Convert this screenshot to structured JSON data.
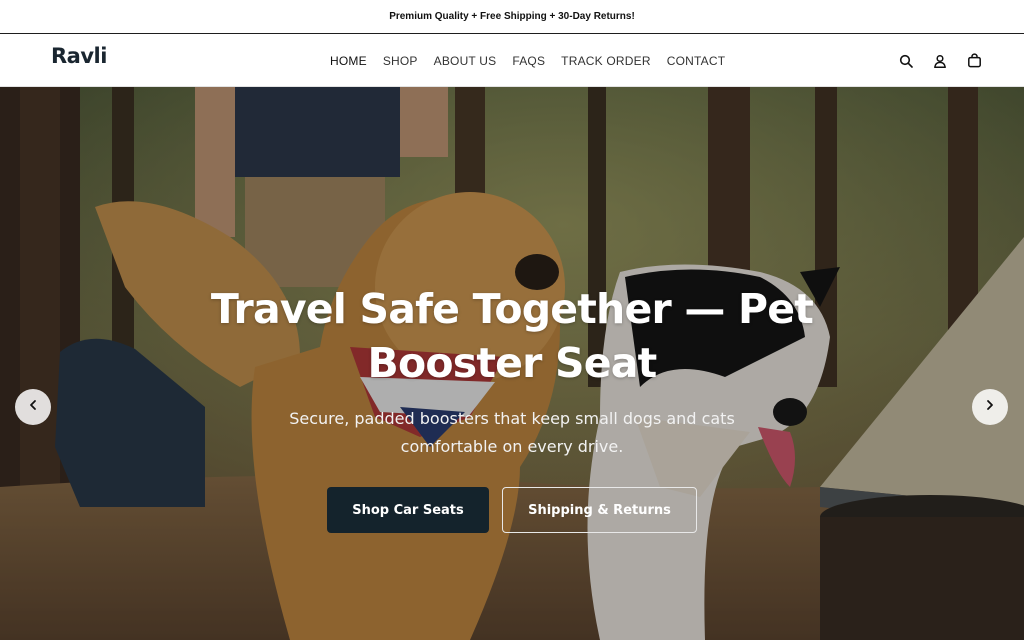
{
  "announcement": {
    "text": "Premium Quality + Free Shipping + 30-Day Returns!"
  },
  "header": {
    "logo": "Ravli",
    "nav": [
      {
        "label": "HOME",
        "active": true
      },
      {
        "label": "SHOP"
      },
      {
        "label": "ABOUT US"
      },
      {
        "label": "FAQS"
      },
      {
        "label": "TRACK ORDER"
      },
      {
        "label": "CONTACT"
      }
    ],
    "icons": [
      "search-icon",
      "account-icon",
      "cart-icon"
    ]
  },
  "hero": {
    "title": "Travel Safe Together — Pet Booster Seat",
    "subtitle": "Secure, padded boosters that keep small dogs and cats comfortable on every drive.",
    "primary_button": "Shop Car Seats",
    "secondary_button": "Shipping & Returns",
    "prev_icon": "chevron-left-icon",
    "next_icon": "chevron-right-icon"
  },
  "colors": {
    "primary_button_bg": "#14232c",
    "logo": "#1a2630"
  }
}
